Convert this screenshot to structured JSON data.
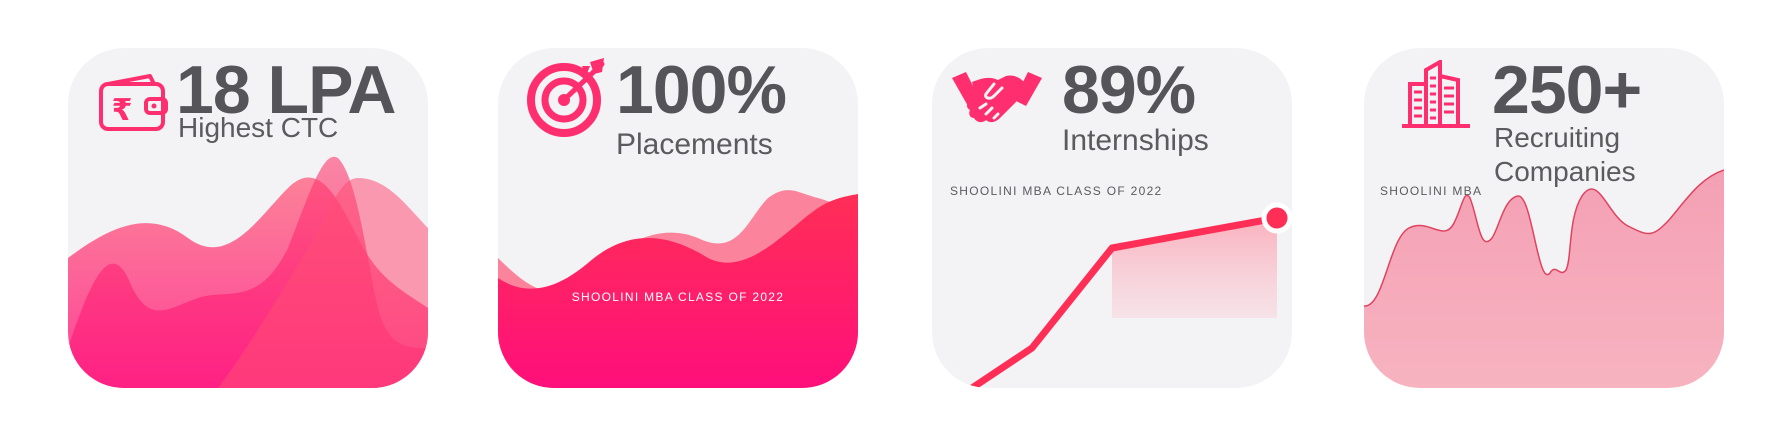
{
  "colors": {
    "accent": "#ff2e6e",
    "accent_dark": "#ff0f7b",
    "card_bg": "#f3f3f5",
    "text_dark": "#555559",
    "text_sub": "#5b5b5f"
  },
  "cards": [
    {
      "icon": "rupee-wallet-icon",
      "value": "18 LPA",
      "label": "Highest CTC"
    },
    {
      "icon": "target-arrow-icon",
      "value": "100%",
      "label": "Placements",
      "caption": "SHOOLINI MBA CLASS OF 2022"
    },
    {
      "icon": "handshake-icon",
      "value": "89%",
      "label": "Internships",
      "caption": "SHOOLINI MBA CLASS OF 2022"
    },
    {
      "icon": "office-building-icon",
      "value": "250+",
      "label_line1": "Recruiting",
      "label_line2": "Companies",
      "caption": "SHOOLINI MBA"
    }
  ]
}
